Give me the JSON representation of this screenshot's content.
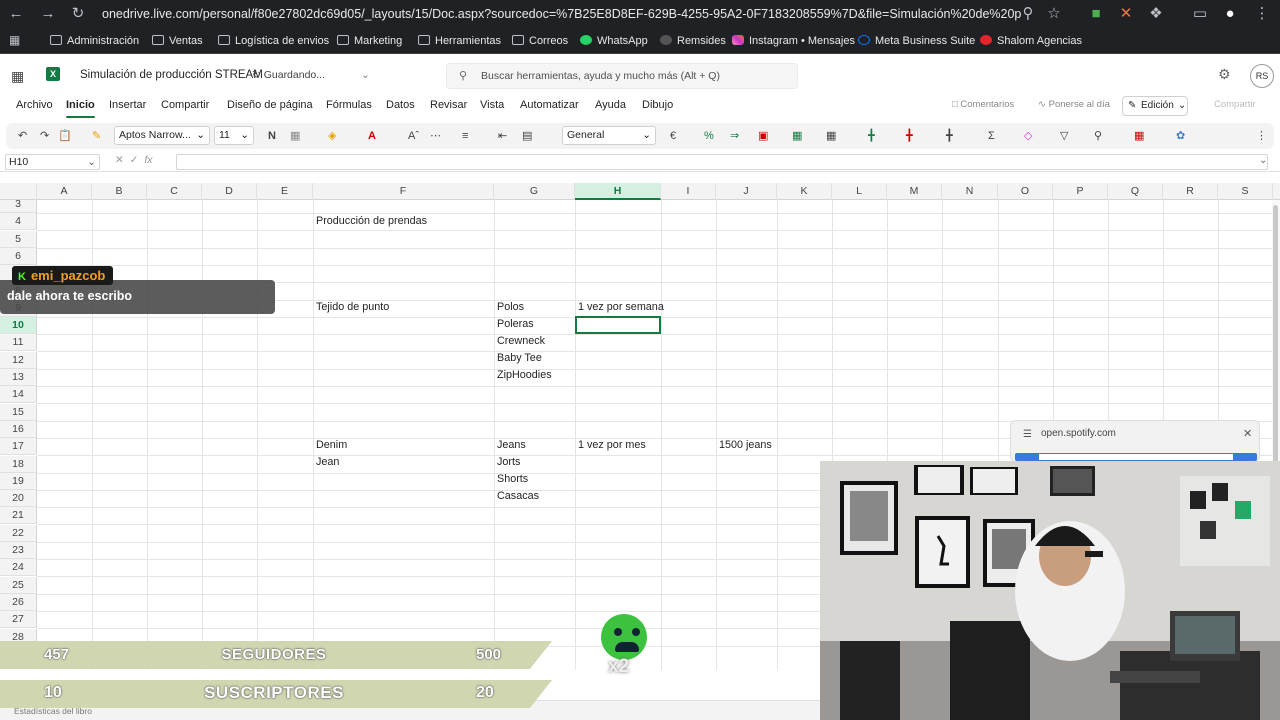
{
  "browser": {
    "url": "onedrive.live.com/personal/f80e27802dc69d05/_layouts/15/Doc.aspx?sourcedoc=%7B25E8D8EF-629B-4255-95A2-0F7183208559%7D&file=Simulación%20de%20produ...",
    "bookmarks": [
      "Administración",
      "Ventas",
      "Logística de envios",
      "Marketing",
      "Herramientas",
      "Correos",
      "WhatsApp",
      "Remsides",
      "Instagram • Mensajes",
      "Meta Business Suite",
      "Shalom Agencias"
    ]
  },
  "app": {
    "doc_title": "Simulación de producción STREAM",
    "saving": "Guardando...",
    "search_placeholder": "Buscar herramientas, ayuda y mucho más (Alt + Q)",
    "avatar_initials": "RS"
  },
  "menu": {
    "items": [
      "Archivo",
      "Inicio",
      "Insertar",
      "Compartir",
      "Diseño de página",
      "Fórmulas",
      "Datos",
      "Revisar",
      "Vista",
      "Automatizar",
      "Ayuda",
      "Dibujo"
    ],
    "comments": "Comentarios",
    "catch_up": "Ponerse al día",
    "editing": "Edición",
    "share": "Compartir"
  },
  "toolbar": {
    "font": "Aptos Narrow...",
    "size": "11",
    "bold": "N",
    "number_format": "General"
  },
  "formula_bar": {
    "name_box": "H10",
    "fx": "fx",
    "value": ""
  },
  "grid": {
    "columns": [
      "A",
      "B",
      "C",
      "D",
      "E",
      "F",
      "G",
      "H",
      "I",
      "J",
      "K",
      "L",
      "M",
      "N",
      "O",
      "P",
      "Q",
      "R",
      "S"
    ],
    "selected_column": "H",
    "rows": [
      "3",
      "4",
      "5",
      "6",
      "7",
      "8",
      "9",
      "10",
      "11",
      "12",
      "13",
      "14",
      "15",
      "16",
      "17",
      "18",
      "19",
      "20",
      "21",
      "22",
      "23",
      "24",
      "25",
      "26",
      "27",
      "28"
    ],
    "selected_row": "10",
    "cells": {
      "F4": "Producción de prendas",
      "F9": "Tejido de punto",
      "G9": "Polos",
      "H9": "1 vez por semana",
      "G10": "Poleras",
      "G11": "Crewneck",
      "G12": "Baby Tee",
      "G13": "ZipHoodies",
      "F17": "Denim",
      "G17": "Jeans",
      "H17": "1 vez por mes",
      "J17": "1500 jeans",
      "F18": "Jean",
      "G18": "Jorts",
      "G19": "Shorts",
      "G20": "Casacas"
    }
  },
  "status": {
    "text": "Estadísticas del libro"
  },
  "overlay": {
    "chat_user": "emi_pazcob",
    "chat_message": "dale ahora te escribo",
    "followers_current": "457",
    "followers_label": "SEGUIDORES",
    "followers_goal": "500",
    "subs_current": "10",
    "subs_label": "SUSCRIPTORES",
    "subs_goal": "20",
    "emote_count": "x2",
    "popup_site": "open.spotify.com"
  },
  "colors": {
    "excel_green": "#107c41",
    "browser_bg": "#202124",
    "goal_bar": "#cfd6b0"
  }
}
